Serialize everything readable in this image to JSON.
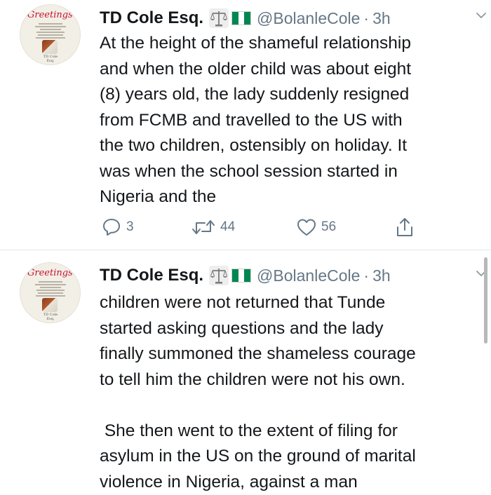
{
  "tweets": [
    {
      "author": {
        "name": "TD Cole Esq.",
        "handle": "@BolanleCole",
        "separator": "·",
        "time": "3h",
        "avatar_greeting": "Greetings",
        "avatar_signature": "TD Cole Esq."
      },
      "text": "At the height of the shameful relationship\nand when the older child was about eight\n(8) years old, the lady suddenly resigned\nfrom FCMB and travelled to the US with\nthe two children, ostensibly on holiday. It\nwas when the school session started in\nNigeria and the",
      "replies": "3",
      "retweets": "44",
      "likes": "56"
    },
    {
      "author": {
        "name": "TD Cole Esq.",
        "handle": "@BolanleCole",
        "separator": "·",
        "time": "3h",
        "avatar_greeting": "Greetings",
        "avatar_signature": "TD Cole Esq."
      },
      "text": "children were not returned that Tunde\nstarted asking questions and the lady\nfinally summoned the shameless courage\nto tell him the children were not his own.\n\n She then went to the extent of filing for\nasylum in the US on the ground of marital\nviolence in Nigeria, against a man"
    }
  ],
  "icons": {
    "verified_emoji": "balance-scale-icon",
    "flag_emoji": "nigeria-flag-icon",
    "menu": "chevron-down-icon",
    "reply": "reply-icon",
    "retweet": "retweet-icon",
    "like": "heart-icon",
    "share": "share-icon"
  },
  "colors": {
    "text": "#14171a",
    "muted": "#657786",
    "divider": "#e1e8ed",
    "flag_green": "#008751"
  }
}
